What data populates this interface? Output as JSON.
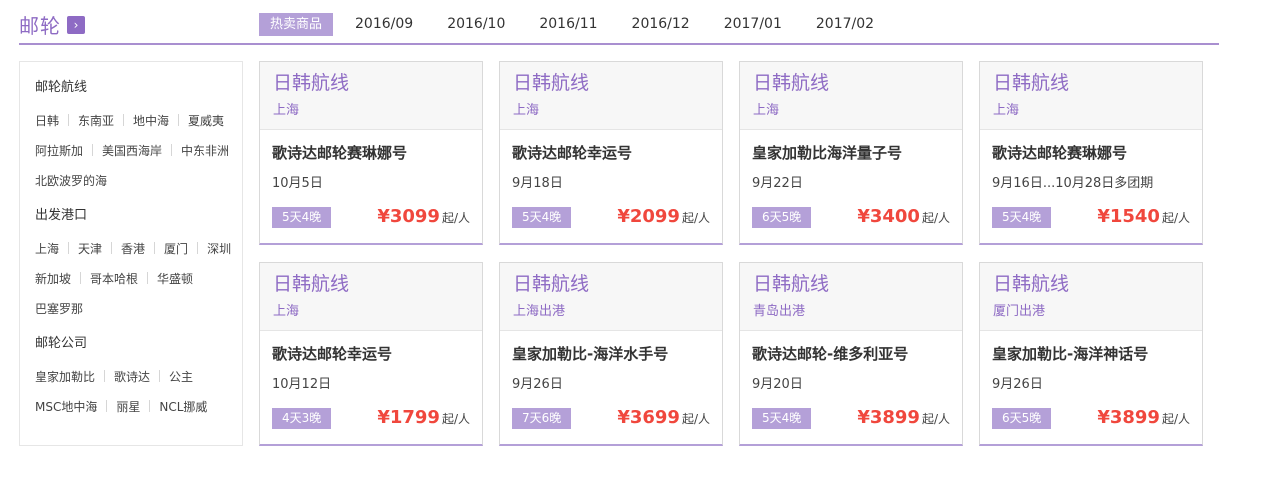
{
  "header": {
    "title": "邮轮",
    "arrow": "›",
    "tabs": [
      {
        "label": "热卖商品",
        "active": true
      },
      {
        "label": "2016/09"
      },
      {
        "label": "2016/10"
      },
      {
        "label": "2016/11"
      },
      {
        "label": "2016/12"
      },
      {
        "label": "2017/01"
      },
      {
        "label": "2017/02"
      }
    ]
  },
  "sidebar": {
    "routes_title": "邮轮航线",
    "routes": [
      [
        "日韩",
        "东南亚",
        "地中海",
        "夏威夷"
      ],
      [
        "阿拉斯加",
        "美国西海岸",
        "中东非洲"
      ],
      [
        "北欧波罗的海"
      ]
    ],
    "ports_title": "出发港口",
    "ports": [
      [
        "上海",
        "天津",
        "香港",
        "厦门",
        "深圳"
      ],
      [
        "新加坡",
        "哥本哈根",
        "华盛顿"
      ],
      [
        "巴塞罗那"
      ]
    ],
    "companies_title": "邮轮公司",
    "companies": [
      [
        "皇家加勒比",
        "歌诗达",
        "公主"
      ],
      [
        "MSC地中海",
        "丽星",
        "NCL挪威"
      ]
    ]
  },
  "cards": [
    {
      "route": "日韩航线",
      "port": "上海",
      "ship": "歌诗达邮轮赛琳娜号",
      "date": "10月5日",
      "days": "5天4晚",
      "price": "¥3099",
      "unit": "起/人"
    },
    {
      "route": "日韩航线",
      "port": "上海",
      "ship": "歌诗达邮轮幸运号",
      "date": "9月18日",
      "days": "5天4晚",
      "price": "¥2099",
      "unit": "起/人"
    },
    {
      "route": "日韩航线",
      "port": "上海",
      "ship": "皇家加勒比海洋量子号",
      "date": "9月22日",
      "days": "6天5晚",
      "price": "¥3400",
      "unit": "起/人"
    },
    {
      "route": "日韩航线",
      "port": "上海",
      "ship": "歌诗达邮轮赛琳娜号",
      "date": "9月16日...10月28日多团期",
      "days": "5天4晚",
      "price": "¥1540",
      "unit": "起/人"
    },
    {
      "route": "日韩航线",
      "port": "上海",
      "ship": "歌诗达邮轮幸运号",
      "date": "10月12日",
      "days": "4天3晚",
      "price": "¥1799",
      "unit": "起/人"
    },
    {
      "route": "日韩航线",
      "port": "上海出港",
      "ship": "皇家加勒比-海洋水手号",
      "date": "9月26日",
      "days": "7天6晚",
      "price": "¥3699",
      "unit": "起/人"
    },
    {
      "route": "日韩航线",
      "port": "青岛出港",
      "ship": "歌诗达邮轮-维多利亚号",
      "date": "9月20日",
      "days": "5天4晚",
      "price": "¥3899",
      "unit": "起/人"
    },
    {
      "route": "日韩航线",
      "port": "厦门出港",
      "ship": "皇家加勒比-海洋神话号",
      "date": "9月26日",
      "days": "6天5晚",
      "price": "¥3899",
      "unit": "起/人"
    }
  ]
}
